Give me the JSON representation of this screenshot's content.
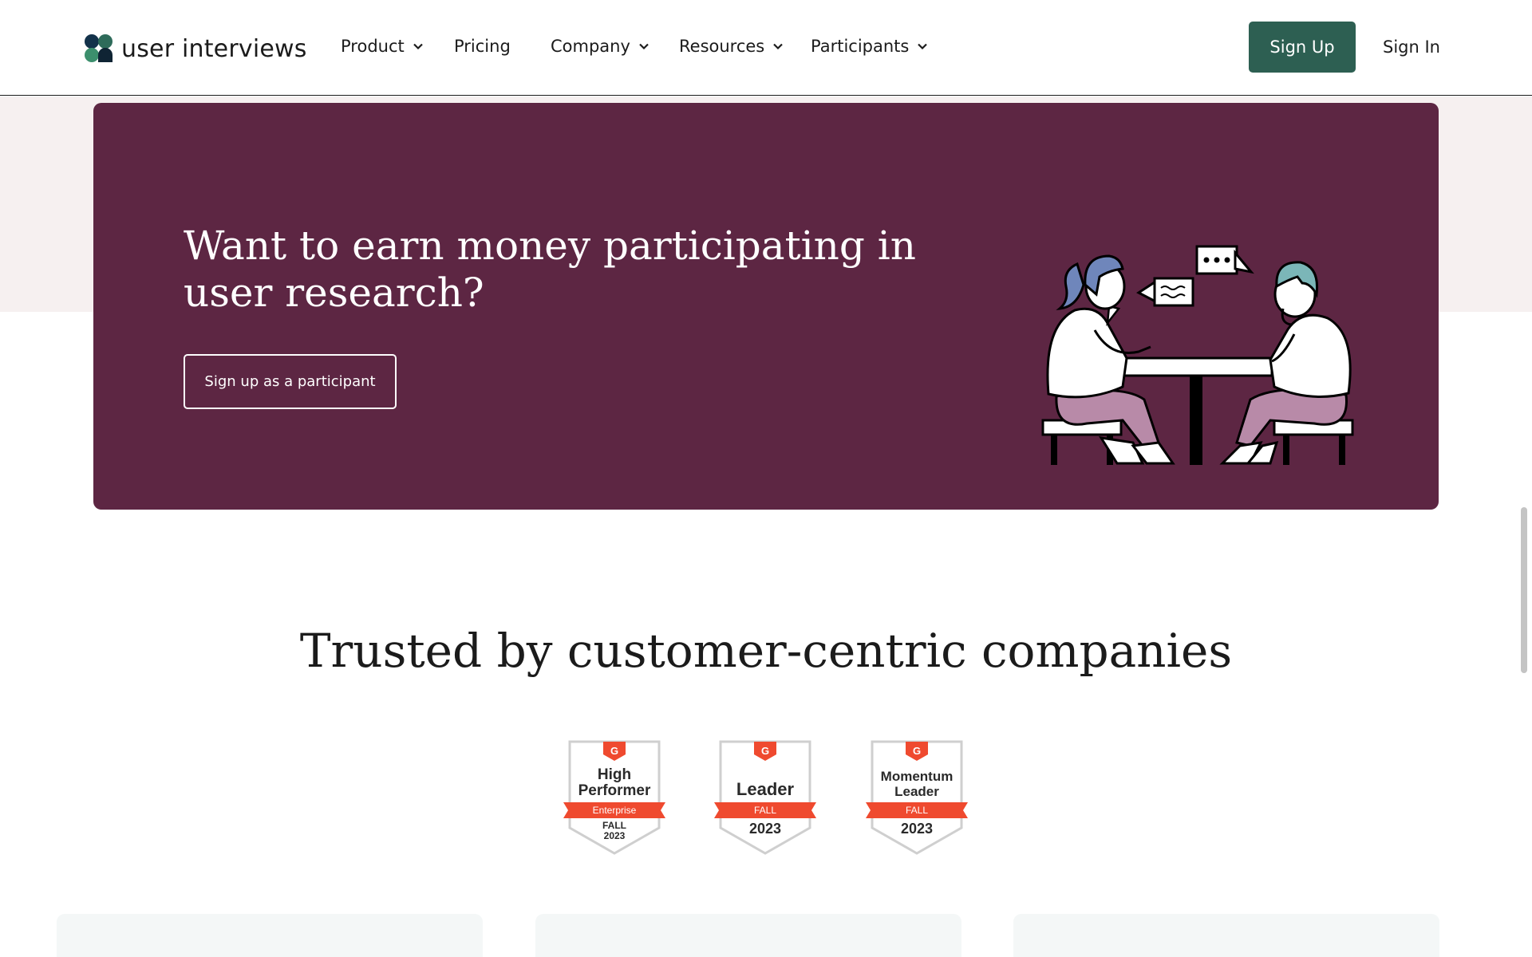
{
  "header": {
    "logo_text": "user interviews",
    "nav": [
      {
        "label": "Product",
        "has_dropdown": true
      },
      {
        "label": "Pricing",
        "has_dropdown": false
      },
      {
        "label": "Company",
        "has_dropdown": true
      },
      {
        "label": "Resources",
        "has_dropdown": true
      },
      {
        "label": "Participants",
        "has_dropdown": true
      }
    ],
    "signup_label": "Sign Up",
    "signin_label": "Sign In"
  },
  "banner": {
    "title": "Want to earn money participating in user research?",
    "button_label": "Sign up as a participant",
    "illustration_icon": "two-people-talking-at-table-illustration",
    "background_color": "#5d2643"
  },
  "trusted": {
    "title": "Trusted by customer-centric companies",
    "badges": [
      {
        "logo": "G2",
        "title_line1": "High",
        "title_line2": "Performer",
        "ribbon": "Enterprise",
        "season": "FALL",
        "year": "2023"
      },
      {
        "logo": "G2",
        "title_line1": "Leader",
        "title_line2": "",
        "ribbon": "FALL",
        "season": "",
        "year": "2023"
      },
      {
        "logo": "G2",
        "title_line1": "Momentum",
        "title_line2": "Leader",
        "ribbon": "FALL",
        "season": "",
        "year": "2023"
      }
    ]
  },
  "colors": {
    "brand_green": "#2d5f52",
    "banner_plum": "#5d2643",
    "g2_red": "#ef4a2f",
    "page_pink": "#f6f0f0"
  }
}
